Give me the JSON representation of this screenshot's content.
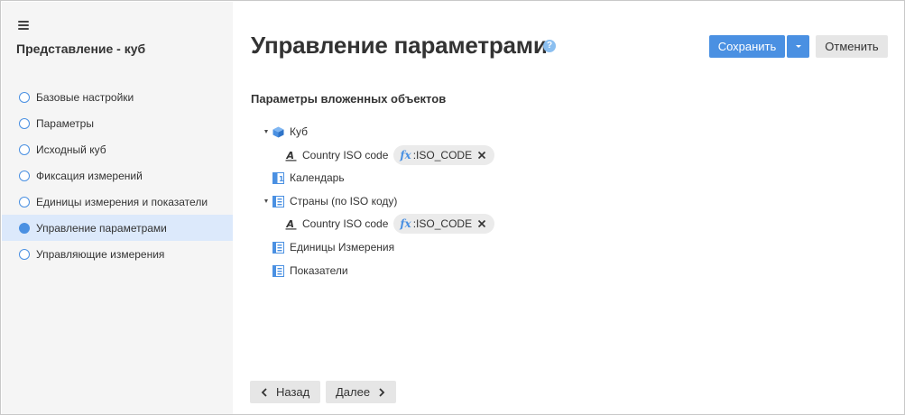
{
  "sidebar": {
    "title": "Представление - куб",
    "items": [
      {
        "label": "Базовые настройки",
        "active": false
      },
      {
        "label": "Параметры",
        "active": false
      },
      {
        "label": "Исходный куб",
        "active": false
      },
      {
        "label": "Фиксация измерений",
        "active": false
      },
      {
        "label": "Единицы измерения и показатели",
        "active": false
      },
      {
        "label": "Управление параметрами",
        "active": true
      },
      {
        "label": "Управляющие измерения",
        "active": false
      }
    ]
  },
  "header": {
    "title": "Управление параметрами",
    "help_icon": "?",
    "save_label": "Сохранить",
    "cancel_label": "Отменить"
  },
  "main": {
    "section_title": "Параметры вложенных объектов",
    "tree": {
      "cube_label": "Куб",
      "cube_param_label": "Country ISO code",
      "cube_param_fx": "fx",
      "cube_param_value": ":ISO_CODE",
      "calendar_label": "Календарь",
      "countries_label": "Страны (по ISO коду)",
      "countries_param_label": "Country ISO code",
      "countries_param_fx": "fx",
      "countries_param_value": ":ISO_CODE",
      "units_label": "Единицы Измерения",
      "indicators_label": "Показатели"
    },
    "back_label": "Назад",
    "next_label": "Далее"
  },
  "colors": {
    "accent": "#4a90e2",
    "active_bg": "#dce9fb",
    "sidebar_bg": "#f5f5f5",
    "chip_bg": "#ebebeb"
  }
}
